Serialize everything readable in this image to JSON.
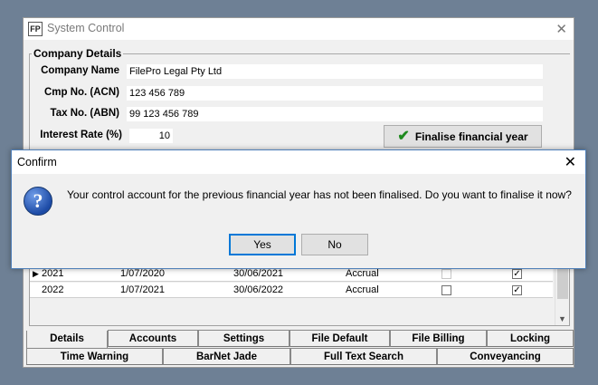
{
  "window": {
    "title": "System Control",
    "app_icon": "filepro-app-icon"
  },
  "company": {
    "legend": "Company Details",
    "name_label": "Company Name",
    "name_value": "FilePro Legal Pty Ltd",
    "acn_label": "Cmp No. (ACN)",
    "acn_value": "123 456 789",
    "abn_label": "Tax No. (ABN)",
    "abn_value": "99 123 456 789",
    "rate_label": "Interest Rate (%)",
    "rate_value": "10",
    "finalise_label": "Finalise financial year"
  },
  "years": [
    {
      "year": "2021",
      "start": "1/07/2020",
      "end": "30/06/2021",
      "basis": "Accrual",
      "flag1": false,
      "flag2": true,
      "current": true
    },
    {
      "year": "2022",
      "start": "1/07/2021",
      "end": "30/06/2022",
      "basis": "Accrual",
      "flag1": false,
      "flag2": true,
      "current": false
    }
  ],
  "tabs_row1": [
    "Details",
    "Accounts",
    "Settings",
    "File Default",
    "File Billing",
    "Locking"
  ],
  "tabs_row2": [
    "Time Warning",
    "BarNet Jade",
    "Full Text Search",
    "Conveyancing"
  ],
  "dialog": {
    "title": "Confirm",
    "icon": "question-icon",
    "message": "Your control account for the previous financial year has not been finalised. Do you want to finalise it now?",
    "yes_label": "Yes",
    "no_label": "No"
  },
  "colors": {
    "desktop": "#6e8095",
    "dialog_border": "#4f7fb8",
    "focus": "#0078d7"
  }
}
